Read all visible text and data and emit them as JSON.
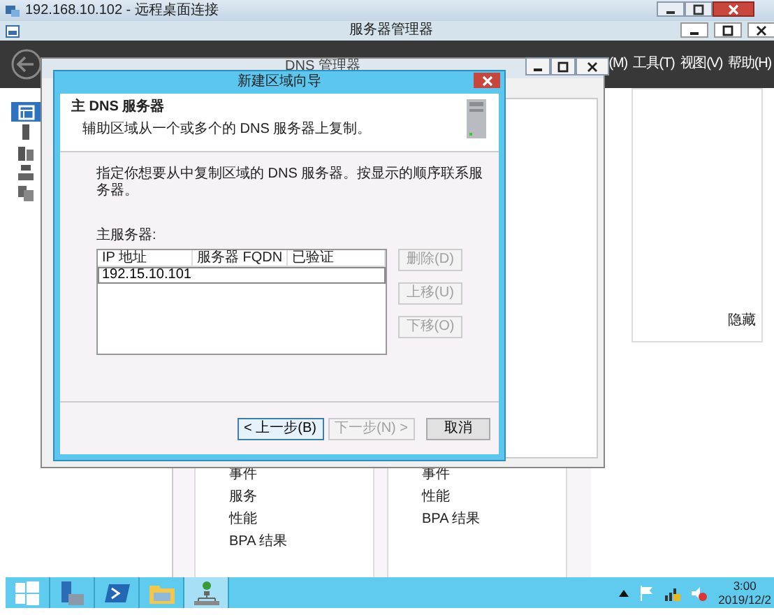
{
  "rdp": {
    "title": "192.168.10.102 - 远程桌面连接"
  },
  "server_manager": {
    "title": "服务器管理器",
    "menus": [
      {
        "label": "(M)"
      },
      {
        "label": "工具(T)"
      },
      {
        "label": "视图(V)"
      },
      {
        "label": "帮助(H)"
      }
    ],
    "sidebar": {
      "items": [
        {
          "kind": "dashboard",
          "selected": true
        },
        {
          "kind": "server",
          "selected": false
        },
        {
          "kind": "servers",
          "selected": false
        },
        {
          "kind": "roles",
          "selected": false
        },
        {
          "kind": "files",
          "selected": false
        }
      ]
    },
    "hide_link": "隐藏",
    "tiles": [
      {
        "items": [
          "事件",
          "服务",
          "性能",
          "BPA 结果"
        ]
      },
      {
        "items": [
          "事件",
          "性能",
          "BPA 结果"
        ]
      }
    ]
  },
  "dns_manager": {
    "title": "DNS 管理器"
  },
  "wizard": {
    "title": "新建区域向导",
    "heading": "主 DNS 服务器",
    "subheading": "辅助区域从一个或多个的 DNS 服务器上复制。",
    "instruction": "指定你想要从中复制区域的 DNS 服务器。按显示的顺序联系服务器。",
    "list_label": "主服务器:",
    "columns": [
      "IP 地址",
      "服务器 FQDN",
      "已验证"
    ],
    "editing_value": "192.15.10.101",
    "side_buttons": [
      {
        "label": "删除(D)",
        "disabled": true
      },
      {
        "label": "上移(U)",
        "disabled": true
      },
      {
        "label": "下移(O)",
        "disabled": true
      }
    ],
    "footer_buttons": [
      {
        "label": "< 上一步(B)",
        "disabled": false,
        "focused": true
      },
      {
        "label": "下一步(N) >",
        "disabled": true,
        "focused": false
      },
      {
        "label": "取消",
        "disabled": false,
        "focused": false
      }
    ]
  },
  "taskbar": {
    "apps": [
      {
        "kind": "start",
        "selected": false
      },
      {
        "kind": "server-manager",
        "selected": false
      },
      {
        "kind": "powershell",
        "selected": false
      },
      {
        "kind": "explorer",
        "selected": false
      },
      {
        "kind": "network",
        "selected": true
      }
    ],
    "clock": {
      "time": "3:00",
      "date": "2019/12/2"
    }
  }
}
